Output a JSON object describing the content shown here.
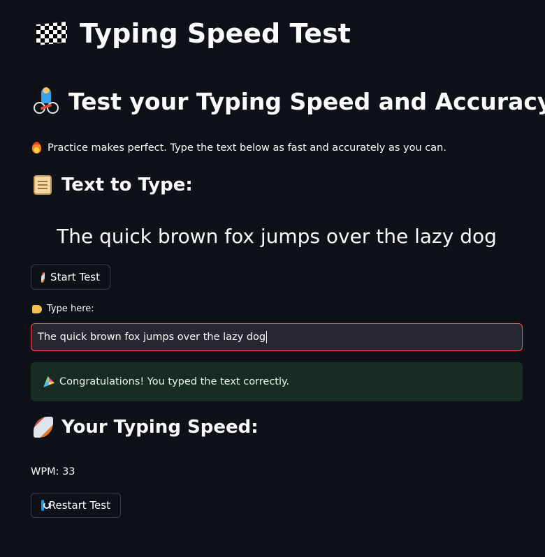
{
  "app": {
    "title": "Typing Speed Test",
    "title_icon": "checkered-flag-icon"
  },
  "intro": {
    "heading": "Test your Typing Speed and Accuracy",
    "heading_icon": "cyclist-icon",
    "tagline": "Practice makes perfect. Type the text below as fast and accurately as you can.",
    "tagline_icon": "fire-icon"
  },
  "prompt": {
    "heading": "Text to Type:",
    "heading_icon": "scroll-icon",
    "sample_text": "The quick brown fox jumps over the lazy dog"
  },
  "controls": {
    "start_label": "Start Test",
    "start_icon": "rocket-icon",
    "restart_label": "Restart Test",
    "restart_icon": "refresh-icon"
  },
  "input": {
    "label": "Type here:",
    "label_icon": "pointing-hand-icon",
    "value": "The quick brown fox jumps over the lazy dog",
    "border_color": "#ff4b4b"
  },
  "result": {
    "message": "Congratulations! You typed the text correctly.",
    "message_icon": "party-popper-icon",
    "status_color": "#172d23"
  },
  "speed": {
    "heading": "Your Typing Speed:",
    "heading_icon": "rocket-icon",
    "wpm_text": "WPM: 33"
  },
  "theme": {
    "background": "#0e1117",
    "text": "#fafafa",
    "input_bg": "#262730"
  }
}
